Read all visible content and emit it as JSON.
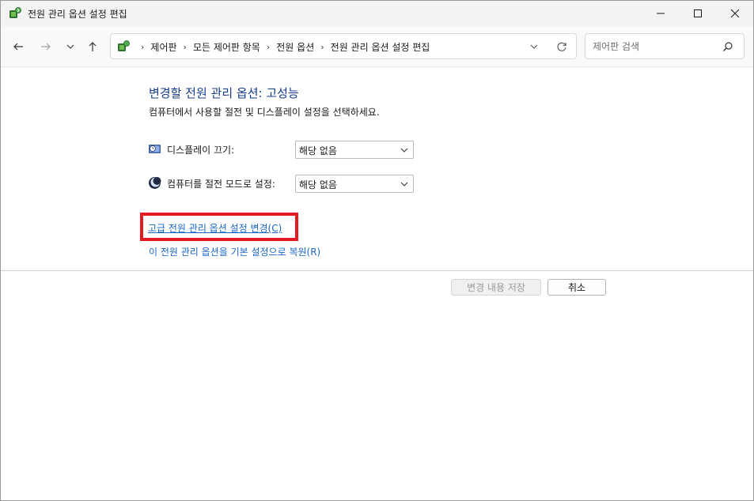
{
  "window": {
    "title": "전원 관리 옵션 설정 편집",
    "icon": "power-options-icon"
  },
  "navigation": {
    "breadcrumbs": [
      "제어판",
      "모든 제어판 항목",
      "전원 옵션",
      "전원 관리 옵션 설정 편집"
    ],
    "search_placeholder": "제어판 검색"
  },
  "content": {
    "heading": "변경할 전원 관리 옵션: 고성능",
    "description": "컴퓨터에서 사용할 절전 및 디스플레이 설정을 선택하세요.",
    "settings": [
      {
        "label": "디스플레이 끄기:",
        "value": "해당 없음",
        "icon": "monitor-clock-icon"
      },
      {
        "label": "컴퓨터를 절전 모드로 설정:",
        "value": "해당 없음",
        "icon": "moon-icon"
      }
    ],
    "links": {
      "advanced": "고급 전원 관리 옵션 설정 변경(C)",
      "restore": "이 전원 관리 옵션을 기본 설정으로 복원(R)"
    },
    "highlight_color": "#e51b23"
  },
  "buttons": {
    "save": "변경 내용 저장",
    "cancel": "취소"
  }
}
